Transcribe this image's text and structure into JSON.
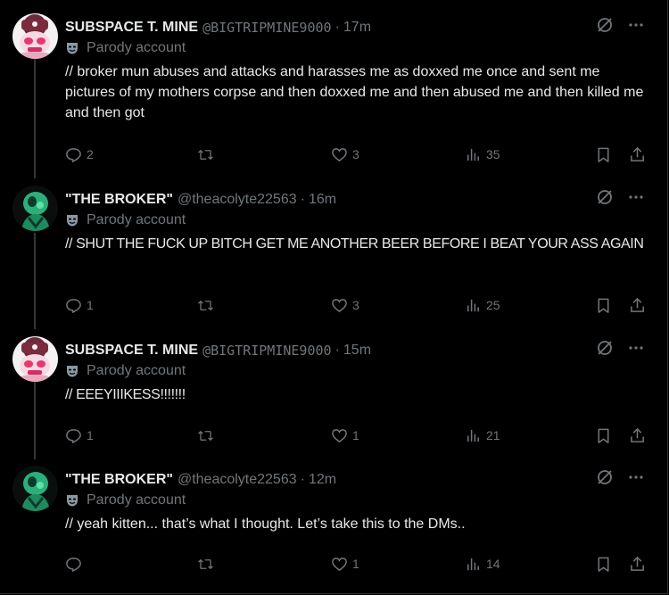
{
  "colors": {
    "background": "#000000",
    "text": "#e7e9ea",
    "muted": "#71767b",
    "thread_line": "#333639"
  },
  "labels": {
    "parody": "Parody account"
  },
  "tweets": [
    {
      "name": "SUBSPACE T. MINE",
      "handle": "@BIGTRIPMINE9000",
      "time": "17m",
      "text": "// broker mun abuses and attacks and harasses me as doxxed me once and sent me pictures of my mothers corpse and then doxxed me and then abused me and then killed me and then got",
      "replies": "2",
      "reposts": "",
      "likes": "3",
      "views": "35",
      "avatar": "pink-skull-avatar"
    },
    {
      "name": "\"THE BROKER\"",
      "handle": "@theacolyte22563",
      "time": "16m",
      "text": "// SHUT THE FUCK UP BITCH GET ME ANOTHER BEER BEFORE I BEAT YOUR ASS AGAIN",
      "replies": "1",
      "reposts": "",
      "likes": "3",
      "views": "25",
      "avatar": "green-figure-avatar"
    },
    {
      "name": "SUBSPACE T. MINE",
      "handle": "@BIGTRIPMINE9000",
      "time": "15m",
      "text": "// EEEYIIIKESS!!!!!!!",
      "replies": "1",
      "reposts": "",
      "likes": "1",
      "views": "21",
      "avatar": "pink-skull-avatar"
    },
    {
      "name": "\"THE BROKER\"",
      "handle": "@theacolyte22563",
      "time": "12m",
      "text": "// yeah kitten... that’s what I thought. Let’s take this to the DMs..",
      "replies": "",
      "reposts": "",
      "likes": "1",
      "views": "14",
      "avatar": "green-figure-avatar"
    }
  ]
}
